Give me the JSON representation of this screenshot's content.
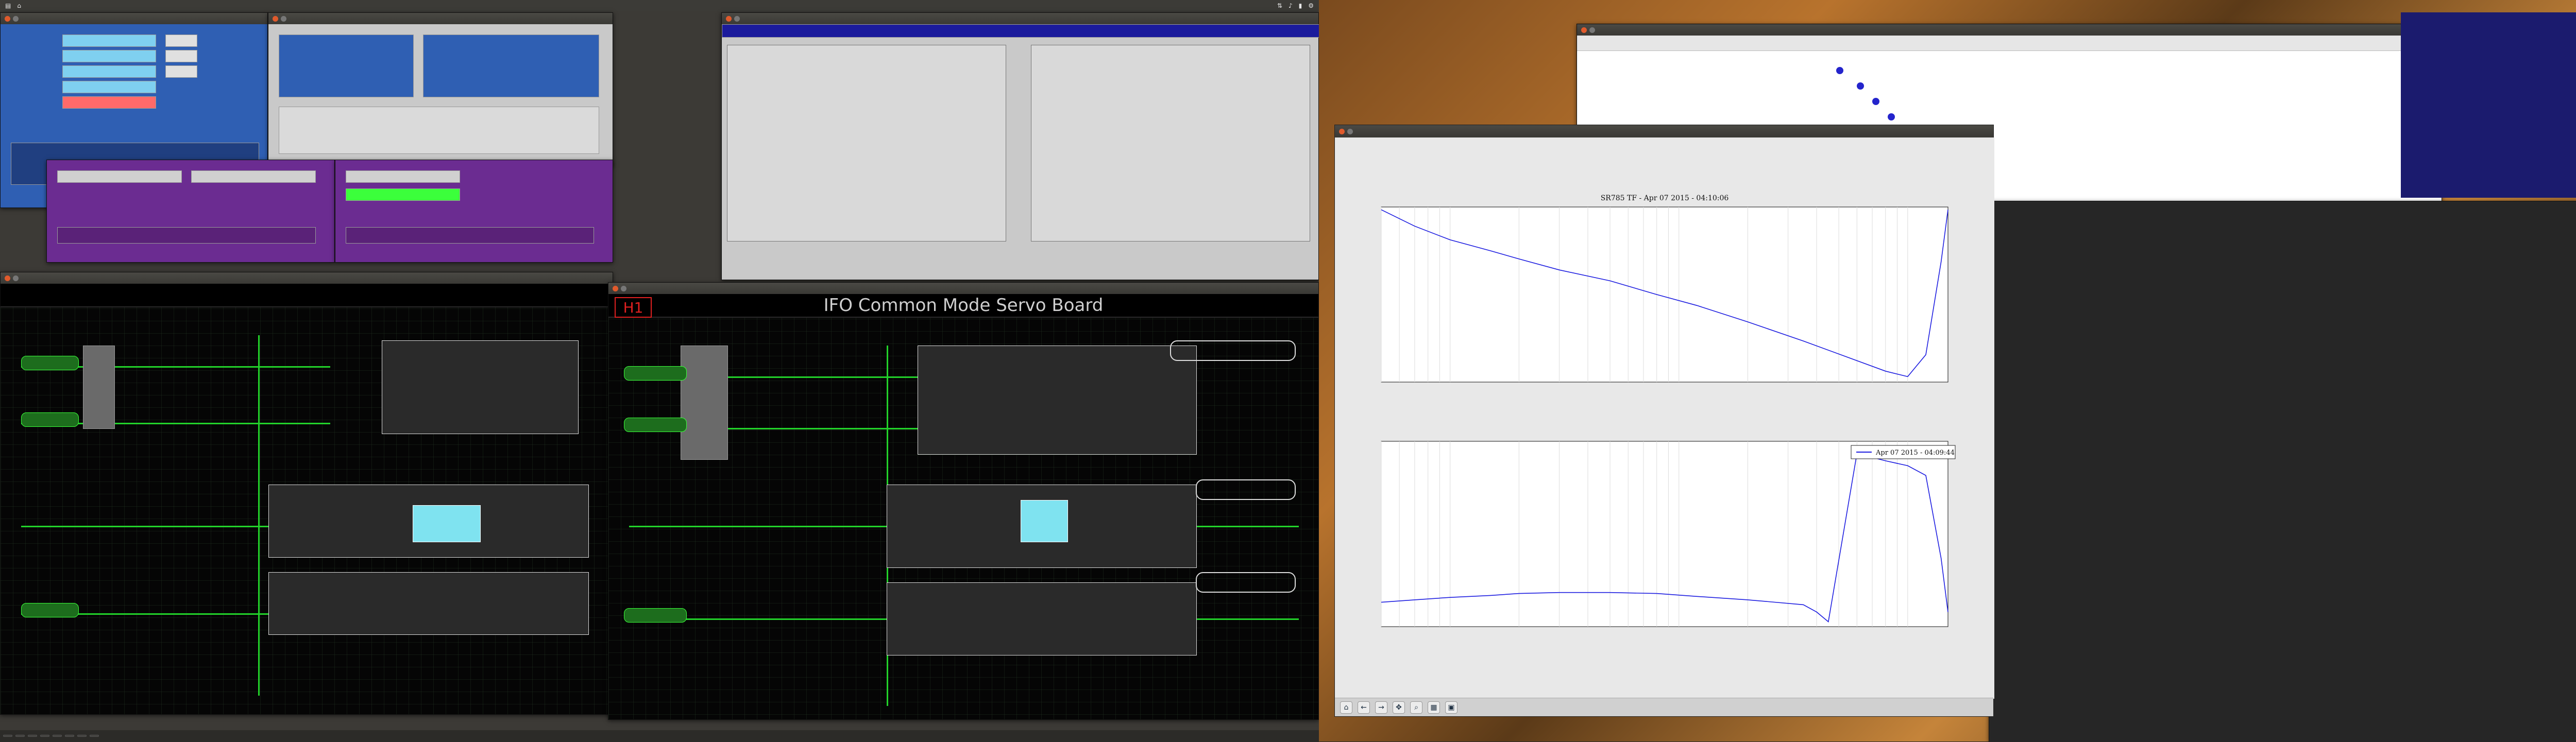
{
  "plot": {
    "title": "SR785 TF - Apr 07 2015 - 04:10:06",
    "legend": "Apr 07 2015 - 04:09:44"
  },
  "colors": {
    "trace": "#1c1ce0",
    "medm_wire": "#22d22a",
    "medm_red": "#e02020"
  },
  "icons": [
    "home-icon",
    "back-icon",
    "forward-icon",
    "pan-icon",
    "zoom-icon",
    "subplots-icon",
    "save-icon"
  ],
  "medm": {
    "ifo_board": {
      "title": "IFO Common Mode Servo Board",
      "site": "H1"
    }
  },
  "chart_data": [
    {
      "type": "line",
      "title": "SR785 TF - Apr 07 2015 - 04:10:06",
      "xscale": "log",
      "xlim": [
        0.5,
        150
      ],
      "ylim": [
        -14,
        18
      ],
      "grid": true,
      "series": [
        {
          "x": [
            0.5,
            0.7,
            1.0,
            1.5,
            2.0,
            3.0,
            5.0,
            8.0,
            12.0,
            20.0,
            35.0,
            55.0,
            80.0,
            100.0,
            120.0,
            140.0,
            150.0
          ],
          "values": [
            17.5,
            14.5,
            12.0,
            10.0,
            8.5,
            6.5,
            4.5,
            2.0,
            0.0,
            -3.0,
            -6.5,
            -9.5,
            -12.0,
            -13.0,
            -9.0,
            8.0,
            17.5
          ]
        }
      ]
    },
    {
      "type": "line",
      "xscale": "log",
      "xlim": [
        0.5,
        150
      ],
      "ylim": [
        -180,
        200
      ],
      "grid": true,
      "legend": "top-right",
      "series": [
        {
          "name": "Apr 07 2015 - 04:09:44",
          "x": [
            0.5,
            0.7,
            1.0,
            1.5,
            2.0,
            3.0,
            5.0,
            8.0,
            12.0,
            20.0,
            35.0,
            40.0,
            45.0,
            60.0,
            80.0,
            100.0,
            120.0,
            140.0,
            150.0
          ],
          "values": [
            -130,
            -125,
            -120,
            -116,
            -112,
            -110,
            -110,
            -112,
            -118,
            -125,
            -135,
            -150,
            -170,
            175,
            160,
            150,
            130,
            -40,
            -150
          ]
        }
      ]
    }
  ]
}
